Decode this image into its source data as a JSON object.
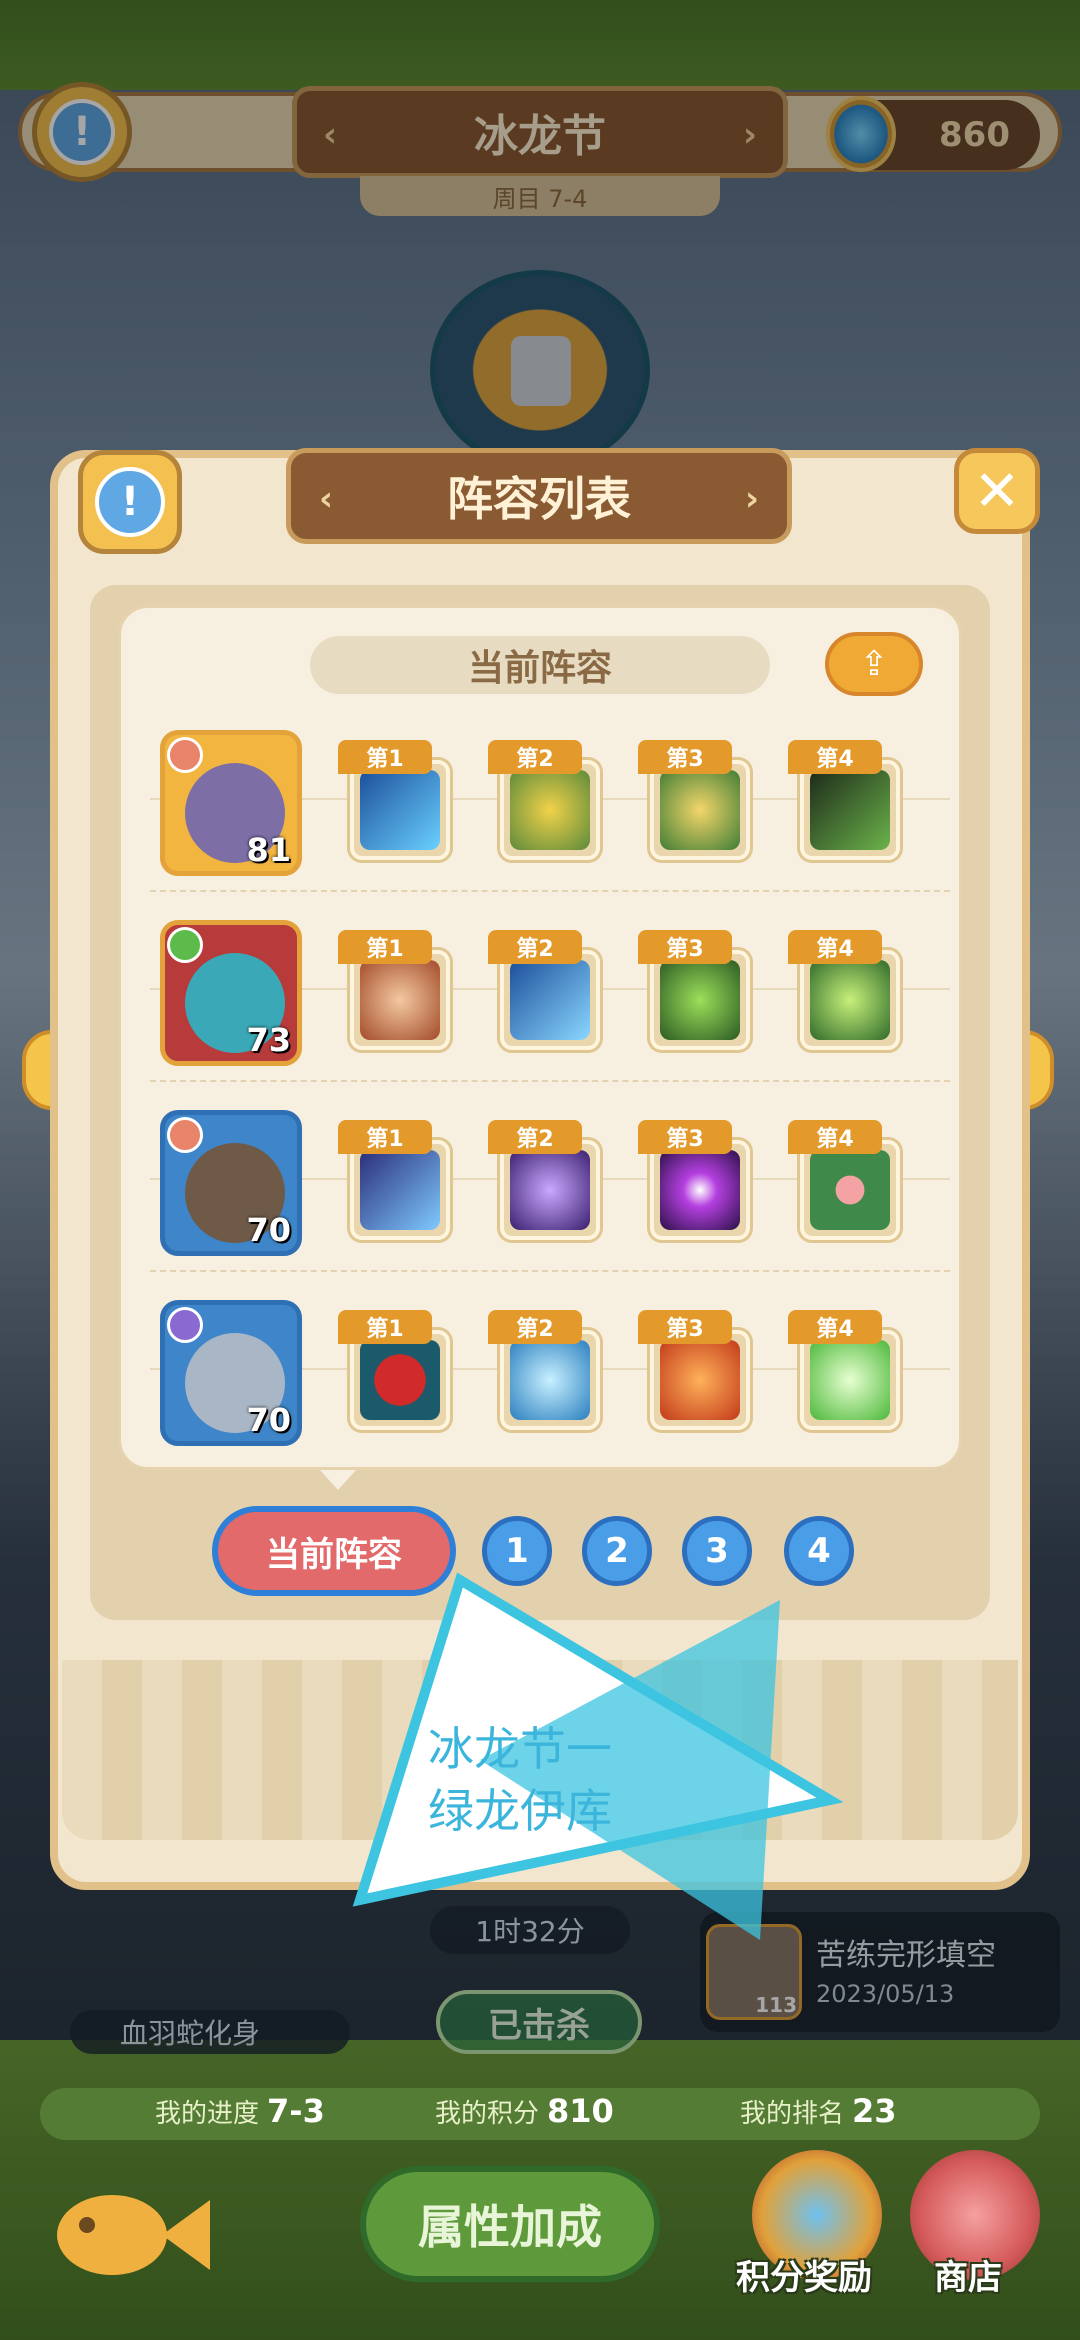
{
  "header": {
    "title": "冰龙节",
    "subtitle": "周目 7-4",
    "coins": "860"
  },
  "panel": {
    "title": "阵容列表",
    "current_label": "当前阵容",
    "rows": [
      {
        "level": "81",
        "skills": [
          "第1",
          "第2",
          "第3",
          "第4"
        ]
      },
      {
        "level": "73",
        "skills": [
          "第1",
          "第2",
          "第3",
          "第4"
        ]
      },
      {
        "level": "70",
        "skills": [
          "第1",
          "第2",
          "第3",
          "第4"
        ]
      },
      {
        "level": "70",
        "skills": [
          "第1",
          "第2",
          "第3",
          "第4"
        ]
      }
    ],
    "tabs": {
      "current": "当前阵容",
      "t1": "1",
      "t2": "2",
      "t3": "3",
      "t4": "4"
    }
  },
  "overlay": {
    "line1": "冰龙节一",
    "line2": "绿龙伊库"
  },
  "behind": {
    "timer": "1时32分",
    "record_title": "苦练完形填空",
    "record_date": "2023/05/13",
    "record_level": "113",
    "boss_name": "血羽蛇化身",
    "killed": "已击杀"
  },
  "bottom": {
    "progress_label": "我的进度",
    "progress_value": "7-3",
    "score_label": "我的积分",
    "score_value": "810",
    "rank_label": "我的排名",
    "rank_value": "23",
    "attr_button": "属性加成",
    "reward_label": "积分奖励",
    "shop_label": "商店"
  },
  "colors": {
    "accent": "#f0a934",
    "panel": "#f2e6cf",
    "title_bg": "#8a5a33",
    "overlay_blue": "#3cc4e0"
  }
}
